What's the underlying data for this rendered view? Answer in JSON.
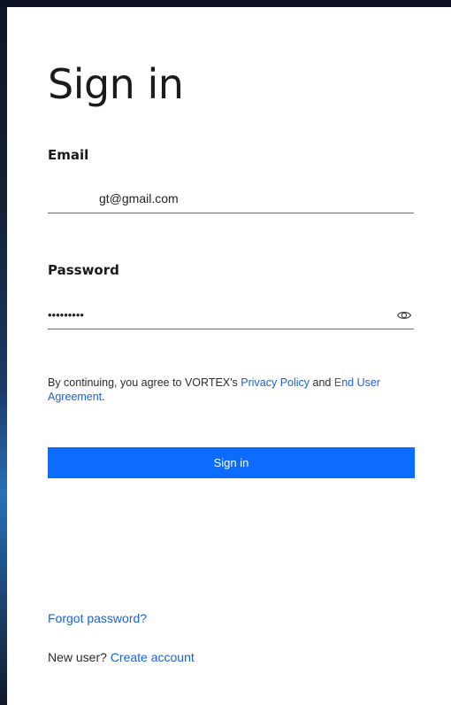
{
  "page": {
    "title": "Sign in"
  },
  "email": {
    "label": "Email",
    "value": "gt@gmail.com"
  },
  "password": {
    "label": "Password",
    "value": "•••••••••",
    "toggle_icon": "eye-icon"
  },
  "consent": {
    "prefix": "By continuing, you agree to VORTEX's ",
    "privacy_link": "Privacy Policy",
    "middle": " and ",
    "eula_link": "End User Agreement",
    "suffix": "."
  },
  "actions": {
    "sign_in_label": "Sign in",
    "forgot_password": "Forgot password?",
    "new_user_prefix": "New user? ",
    "create_account": "Create account"
  },
  "colors": {
    "accent": "#0b6cff",
    "link": "#1a62d1",
    "text": "#1b1b1b"
  }
}
